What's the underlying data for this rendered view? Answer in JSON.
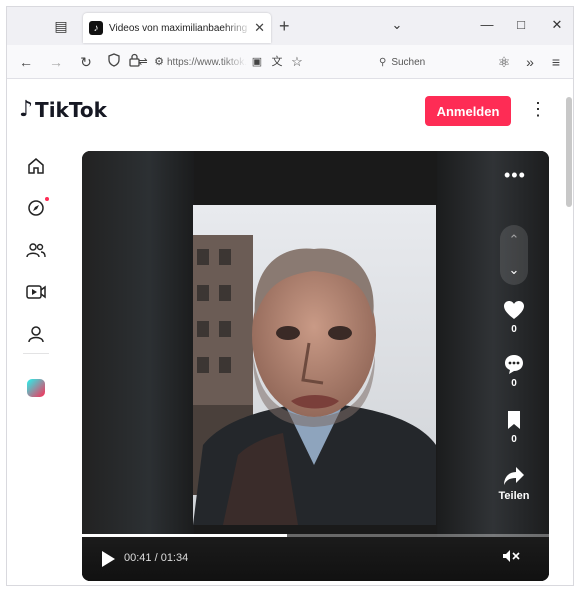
{
  "browser": {
    "tab_title": "Videos von maximilianbaehring",
    "url": "https://www.tiktok.com",
    "search_placeholder": "Suchen"
  },
  "site": {
    "logo_text": "TikTok",
    "login_label": "Anmelden"
  },
  "video": {
    "likes": "0",
    "comments": "0",
    "saves": "0",
    "share_label": "Teilen",
    "time": "00:41 / 01:34",
    "progress": 0.44
  },
  "colors": {
    "brand": "#fe2c55",
    "player_bg": "#1a1a1a"
  },
  "icons": {
    "home": "home-icon",
    "explore": "compass-icon",
    "following": "users-icon",
    "live": "live-icon",
    "profile": "profile-icon"
  }
}
